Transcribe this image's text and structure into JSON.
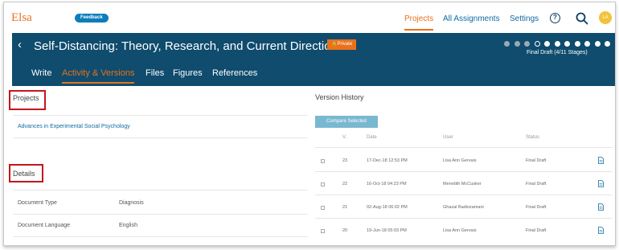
{
  "app": {
    "brand": "Elsa",
    "feedback_label": "Feedback"
  },
  "nav": {
    "items": [
      {
        "label": "Projects",
        "active": true
      },
      {
        "label": "All Assignments",
        "active": false
      },
      {
        "label": "Settings",
        "active": false
      }
    ],
    "help_icon": "question-circle-icon",
    "search_icon": "search-icon",
    "avatar_initials": "LA"
  },
  "document": {
    "title": "Self-Distancing: Theory, Research, and Current Directions",
    "privacy_badge": "Private",
    "stage_label": "Final Draft (4/11 Stages)",
    "stages_total": 11,
    "stages_completed": 4,
    "tabs": [
      {
        "label": "Write",
        "active": false
      },
      {
        "label": "Activity & Versions",
        "active": true
      },
      {
        "label": "Files",
        "active": false
      },
      {
        "label": "Figures",
        "active": false
      },
      {
        "label": "References",
        "active": false
      }
    ]
  },
  "projects": {
    "heading": "Projects",
    "items": [
      "Advances in Experimental Social Psychology"
    ]
  },
  "details": {
    "heading": "Details",
    "rows": [
      {
        "key": "Document Type",
        "value": "Diagnosis"
      },
      {
        "key": "Document Language",
        "value": "English"
      }
    ]
  },
  "version_history": {
    "heading": "Version History",
    "compare_label": "Compare Selected",
    "columns": {
      "version": "V.",
      "date": "Date",
      "user": "User",
      "status": "Status"
    },
    "rows": [
      {
        "version": "23",
        "date": "17-Dec-18 12:53 PM",
        "user": "Lisa Ann Gervais",
        "status": "Final Draft"
      },
      {
        "version": "22",
        "date": "16-Oct-18 04:23 PM",
        "user": "Meredith McCusker",
        "status": "Final Draft"
      },
      {
        "version": "21",
        "date": "02-Aug-18 06:02 PM",
        "user": "Ghazal Badiozamani",
        "status": "Final Draft"
      },
      {
        "version": "20",
        "date": "19-Jun-18 05:03 PM",
        "user": "Lisa Ann Gervais",
        "status": "Final Draft"
      }
    ]
  },
  "colors": {
    "accent_orange": "#e9711c",
    "header_navy": "#0f4c6e",
    "link_blue": "#0f6aa3",
    "highlight_red": "#c4161c"
  }
}
